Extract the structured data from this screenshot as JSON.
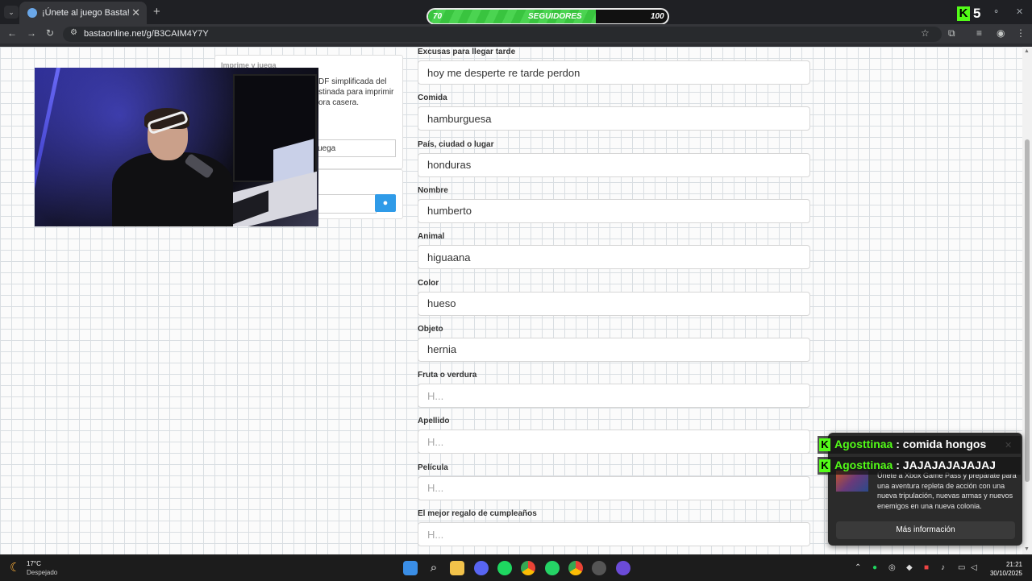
{
  "browser": {
    "tab_title": "¡Únete al juego Basta!",
    "tab_close": "✕",
    "new_tab": "+",
    "url": "bastaonline.net/g/B3CAIM4Y7Y"
  },
  "overlay": {
    "followers": {
      "current": "70",
      "label": "SEGUIDORES",
      "goal": "100",
      "progress": 0.7
    },
    "kick_count": "5",
    "chat": [
      {
        "user": "Agosttinaa",
        "sep": " : ",
        "text": "comida hongos"
      },
      {
        "user": "Agosttinaa",
        "sep": " : ",
        "text": "JAJAJAJAJAJAJ"
      }
    ]
  },
  "sidebar": {
    "print_title": "Imprime y juega",
    "print_desc": "DF simplificada del\nstinada para imprimir\nora casera.",
    "print_button": "uega"
  },
  "form": {
    "fields": [
      {
        "label": "Excusas para llegar tarde",
        "value": "hoy me desperte re tarde perdon",
        "placeholder": ""
      },
      {
        "label": "Comida",
        "value": "hamburguesa",
        "placeholder": ""
      },
      {
        "label": "País, ciudad o lugar",
        "value": "honduras",
        "placeholder": ""
      },
      {
        "label": "Nombre",
        "value": "humberto",
        "placeholder": ""
      },
      {
        "label": "Animal",
        "value": "higuaana",
        "placeholder": ""
      },
      {
        "label": "Color",
        "value": "hueso",
        "placeholder": ""
      },
      {
        "label": "Objeto",
        "value": "hernia",
        "placeholder": ""
      },
      {
        "label": "Fruta o verdura",
        "value": "",
        "placeholder": "H..."
      },
      {
        "label": "Apellido",
        "value": "",
        "placeholder": "H..."
      },
      {
        "label": "Película",
        "value": "",
        "placeholder": "H..."
      },
      {
        "label": "El mejor regalo de cumpleaños",
        "value": "",
        "placeholder": "H..."
      }
    ]
  },
  "toast": {
    "text": "Únete a Xbox Game Pass y prepárate para una aventura repleta de acción con una nueva tripulación, nuevas armas y nuevos enemigos en una nueva colonia.",
    "button": "Más información",
    "close": "✕"
  },
  "taskbar": {
    "temp": "17°C",
    "weather": "Despejado",
    "time": "21:21",
    "date": "30/10/2025"
  },
  "colors": {
    "kick_green": "#53fc18",
    "chrome_dark": "#35363a",
    "primary_button": "#2f9be8"
  }
}
